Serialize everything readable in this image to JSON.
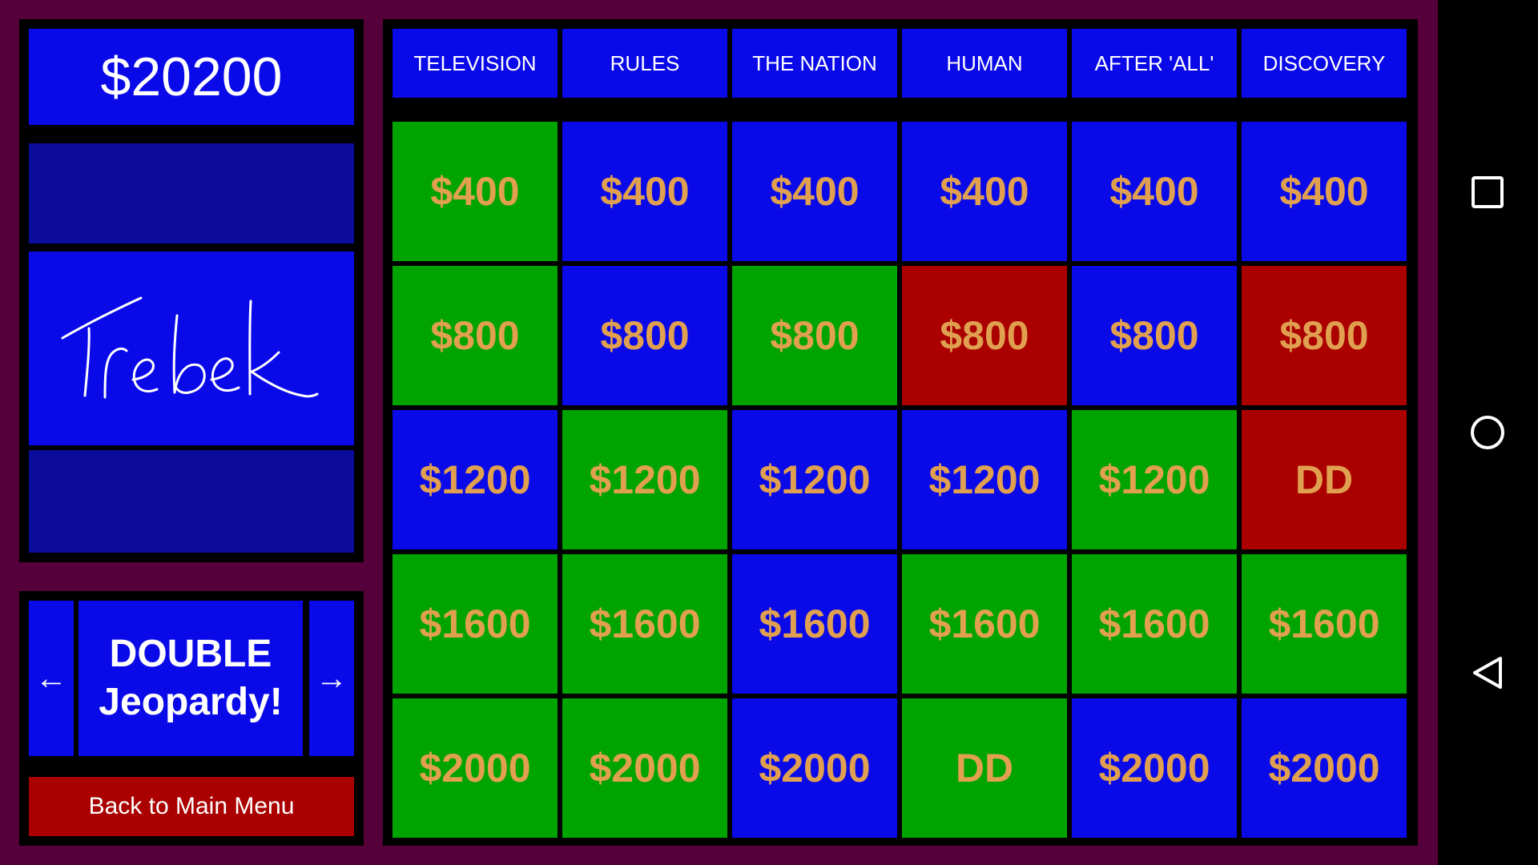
{
  "player": {
    "score": "$20200",
    "name": "Trebek"
  },
  "round": {
    "title": "DOUBLE\nJeopardy!",
    "prev_label": "←",
    "next_label": "→"
  },
  "back_button": {
    "label": "Back to Main Menu"
  },
  "board": {
    "categories": [
      "TELEVISION",
      "RULES",
      "THE NATION",
      "HUMAN",
      "AFTER 'ALL'",
      "DISCOVERY"
    ],
    "rows": [
      [
        {
          "label": "$400",
          "status": "green"
        },
        {
          "label": "$400",
          "status": "blue"
        },
        {
          "label": "$400",
          "status": "blue"
        },
        {
          "label": "$400",
          "status": "blue"
        },
        {
          "label": "$400",
          "status": "blue"
        },
        {
          "label": "$400",
          "status": "blue"
        }
      ],
      [
        {
          "label": "$800",
          "status": "green"
        },
        {
          "label": "$800",
          "status": "blue"
        },
        {
          "label": "$800",
          "status": "green"
        },
        {
          "label": "$800",
          "status": "red"
        },
        {
          "label": "$800",
          "status": "blue"
        },
        {
          "label": "$800",
          "status": "red"
        }
      ],
      [
        {
          "label": "$1200",
          "status": "blue"
        },
        {
          "label": "$1200",
          "status": "green"
        },
        {
          "label": "$1200",
          "status": "blue"
        },
        {
          "label": "$1200",
          "status": "blue"
        },
        {
          "label": "$1200",
          "status": "green"
        },
        {
          "label": "DD",
          "status": "red"
        }
      ],
      [
        {
          "label": "$1600",
          "status": "green"
        },
        {
          "label": "$1600",
          "status": "green"
        },
        {
          "label": "$1600",
          "status": "blue"
        },
        {
          "label": "$1600",
          "status": "green"
        },
        {
          "label": "$1600",
          "status": "green"
        },
        {
          "label": "$1600",
          "status": "green"
        }
      ],
      [
        {
          "label": "$2000",
          "status": "green"
        },
        {
          "label": "$2000",
          "status": "green"
        },
        {
          "label": "$2000",
          "status": "blue"
        },
        {
          "label": "DD",
          "status": "green"
        },
        {
          "label": "$2000",
          "status": "blue"
        },
        {
          "label": "$2000",
          "status": "blue"
        }
      ]
    ]
  },
  "colors": {
    "background": "#56003b",
    "tile_blue": "#0a0ae8",
    "tile_green": "#00a400",
    "tile_red": "#aa0000",
    "value_text": "#e0a050"
  },
  "system_nav": {
    "icons": [
      "recent-apps-icon",
      "home-icon",
      "back-icon"
    ]
  }
}
